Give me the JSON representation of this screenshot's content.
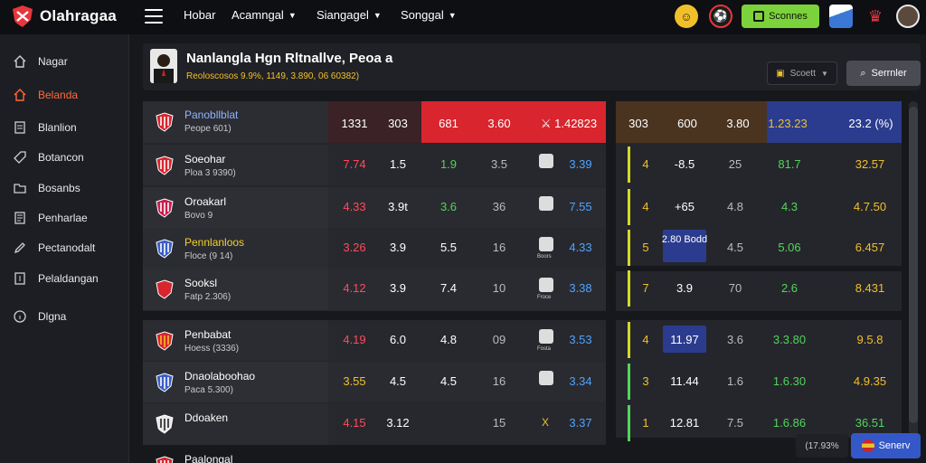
{
  "app": {
    "title": "Olahragaa"
  },
  "nav": [
    {
      "label": "Hobar",
      "dropdown": false
    },
    {
      "label": "Acamngal",
      "dropdown": true
    },
    {
      "label": "Siangagel",
      "dropdown": true
    },
    {
      "label": "Songgal",
      "dropdown": true
    }
  ],
  "top_actions": {
    "promo_label": "Sconnes"
  },
  "sidebar": {
    "items": [
      {
        "label": "Nagar",
        "icon": "home-icon",
        "active": false
      },
      {
        "label": "Belanda",
        "icon": "house-icon",
        "active": true
      },
      {
        "label": "Blanlion",
        "icon": "document-icon",
        "active": false
      },
      {
        "label": "Botancon",
        "icon": "tag-icon",
        "active": false
      },
      {
        "label": "Bosanbs",
        "icon": "folder-icon",
        "active": false
      },
      {
        "label": "Penharlae",
        "icon": "list-icon",
        "active": false
      },
      {
        "label": "Pectanodalt",
        "icon": "pen-icon",
        "active": false
      },
      {
        "label": "Pelaldangan",
        "icon": "note-icon",
        "active": false
      },
      {
        "label": "Dlgna",
        "icon": "info-icon",
        "active": false
      }
    ]
  },
  "match": {
    "title": "Nanlangla Hgn Rltnallve, Peoa a",
    "subtitle": "Reoloscosos 9.9%, 1149, 3.890, 06 60382)",
    "filter_label": "Scoett",
    "search_label": "Serrnler"
  },
  "table": {
    "header_left": {
      "team_name": "Panobllblat",
      "team_sub": "Peope 601)",
      "cols": [
        "1331",
        "303",
        "681",
        "3.60",
        "1.42823"
      ]
    },
    "header_right": {
      "cols": [
        "303",
        "600",
        "3.80",
        "1.23.23",
        "23.2 (%)"
      ]
    },
    "rows": [
      {
        "team": "Soeohar",
        "sub": "Ploa 3 9390)",
        "c1": "7.74",
        "c2": "1.5",
        "c3": "1.9",
        "c4": "3.5",
        "book": "",
        "c5": "3.39",
        "r1": "4",
        "r2": "-8.5",
        "r3": "25",
        "r4": "81.7",
        "r5": "32.57",
        "c1color": "#ff4a5a",
        "c3color": "#52d55a",
        "r4color": "#52d55a",
        "r5color": "#f0c02a",
        "bar": "#d6d82a"
      },
      {
        "team": "Oroakarl",
        "sub": "Bovo 9",
        "c1": "4.33",
        "c2": "3.9t",
        "c3": "3.6",
        "c4": "36",
        "book": "",
        "c5": "7.55",
        "r1": "4",
        "r2": "+65",
        "r3": "4.8",
        "r4": "4.3",
        "r5": "4.7.50",
        "c1color": "#ff4a5a",
        "c3color": "#52d55a",
        "r4color": "#52d55a",
        "r5color": "#f0c02a",
        "bar": "#d6d82a"
      },
      {
        "team": "Pennlanloos",
        "sub": "Floce (9 14)",
        "c1": "3.26",
        "c2": "3.9",
        "c3": "5.5",
        "c4": "16",
        "book": "Boors",
        "c5": "4.33",
        "r1": "5",
        "r2": "2.80 Bodd",
        "r3": "4.5",
        "r4": "5.06",
        "r5": "6.457",
        "c1color": "#ff4a5a",
        "c3color": "#ffffff",
        "r4color": "#52d55a",
        "r5color": "#f0c02a",
        "bar": "#d6d82a",
        "highlight": true
      },
      {
        "team": "Sooksl",
        "sub": "Fatp 2.306)",
        "c1": "4.12",
        "c2": "3.9",
        "c3": "7.4",
        "c4": "10",
        "book": "Froce",
        "c5": "3.38",
        "r1": "7",
        "r2": "3.9",
        "r3": "70",
        "r4": "2.6",
        "r5": "8.431",
        "c1color": "#ff4a5a",
        "c3color": "#ffffff",
        "r4color": "#52d55a",
        "r5color": "#f0c02a",
        "bar": "#d6d82a"
      },
      {
        "team": "Penbabat",
        "sub": "Hoess (3336)",
        "c1": "4.19",
        "c2": "6.0",
        "c3": "4.8",
        "c4": "09",
        "book": "Fosta",
        "c5": "3.53",
        "r1": "4",
        "r2": "11.97",
        "r3": "3.6",
        "r4": "3.3.80",
        "r5": "9.5.8",
        "c1color": "#ff4a5a",
        "c3color": "#ffffff",
        "r4color": "#52d55a",
        "r5color": "#f0c02a",
        "bar": "#d6d82a",
        "r2box": true
      },
      {
        "team": "Dnaolaboohao",
        "sub": "Paca 5.300)",
        "c1": "3.55",
        "c2": "4.5",
        "c3": "4.5",
        "c4": "16",
        "book": "",
        "c5": "3.34",
        "r1": "3",
        "r2": "11.44",
        "r3": "1.6",
        "r4": "1.6.30",
        "r5": "4.9.35",
        "c1color": "#f0c02a",
        "c3color": "#ffffff",
        "r4color": "#52d55a",
        "r5color": "#f0c02a",
        "bar": "#52d55a"
      },
      {
        "team": "Ddoaken",
        "sub": "",
        "c1": "4.15",
        "c2": "3.12",
        "c3": "",
        "c4": "15",
        "book": "X",
        "c5": "3.37",
        "r1": "1",
        "r2": "12.81",
        "r3": "7.5",
        "r4": "1.6.86",
        "r5": "36.51",
        "c1color": "#ff4a5a",
        "c3color": "#ffffff",
        "r4color": "#52d55a",
        "r5color": "#52d55a",
        "bar": "#52d55a"
      },
      {
        "team": "Paalongal",
        "sub": "",
        "c1": "",
        "c2": "",
        "c3": "",
        "c4": "",
        "book": "",
        "c5": "",
        "r1": "",
        "r2": "",
        "r3": "",
        "r4": "",
        "r5": "",
        "c1color": "#ff4a5a",
        "c3color": "#ffffff",
        "r4color": "#52d55a",
        "r5color": "#f0c02a",
        "bar": "#52d55a"
      }
    ]
  },
  "footer": {
    "pill_label": "(17.93%",
    "button_label": "Senerv"
  },
  "colors": {
    "accent": "#ff6a3d",
    "green": "#52d55a",
    "yellow": "#f0c02a",
    "red_header": "#d9252e",
    "blue_header": "#2b3c8e",
    "brown_header": "#4a3420"
  }
}
